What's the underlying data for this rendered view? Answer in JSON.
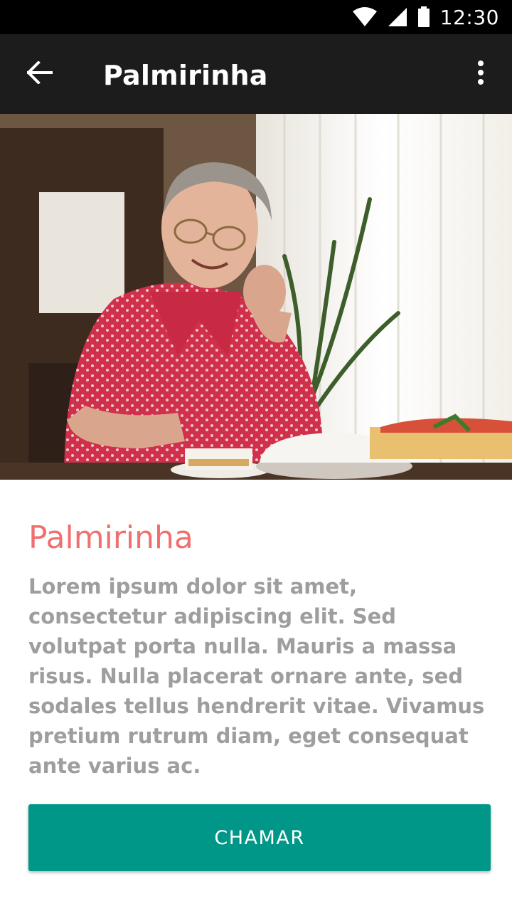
{
  "status_bar": {
    "time": "12:30",
    "icons": [
      "wifi-icon",
      "signal-icon",
      "battery-icon"
    ]
  },
  "app_bar": {
    "title": "Palmirinha",
    "back_icon": "arrow-back-icon",
    "overflow_icon": "more-vert-icon"
  },
  "hero": {
    "image": "photo of an elderly woman in a red floral shirt serving cakes at a table"
  },
  "profile": {
    "name": "Palmirinha",
    "description": "Lorem ipsum dolor sit amet, consectetur adipiscing elit. Sed volutpat porta nulla. Mauris a massa risus. Nulla placerat ornare ante, sed sodales tellus hendrerit vitae. Vivamus pretium rutrum diam, eget consequat ante varius ac."
  },
  "actions": {
    "call_label": "CHAMAR"
  },
  "colors": {
    "status_bar": "#000000",
    "app_bar": "#1c1c1c",
    "accent_name": "#f07070",
    "body_text": "#9e9e9e",
    "button": "#009688"
  }
}
